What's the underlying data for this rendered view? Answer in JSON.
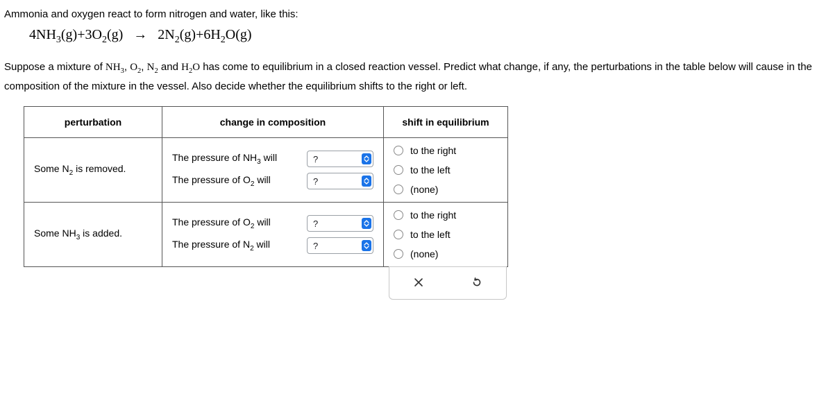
{
  "intro": {
    "line1": "Ammonia and oxygen react to form nitrogen and water, like this:",
    "eqn_lhs1": "4NH",
    "eqn_lhs1_sub": "3",
    "eqn_lhs1_state": "(g)",
    "eqn_plus1": "+",
    "eqn_lhs2": "3O",
    "eqn_lhs2_sub": "2",
    "eqn_lhs2_state": "(g)",
    "arrow": "→",
    "eqn_rhs1": "2N",
    "eqn_rhs1_sub": "2",
    "eqn_rhs1_state": "(g)",
    "eqn_plus2": "+",
    "eqn_rhs2": "6H",
    "eqn_rhs2_sub": "2",
    "eqn_rhs2_o": "O",
    "eqn_rhs2_state": "(g)",
    "line2a": "Suppose a mixture of ",
    "mix1": "NH",
    "mix1_sub": "3",
    "sep1": ", ",
    "mix2": "O",
    "mix2_sub": "2",
    "sep2": ", ",
    "mix3": "N",
    "mix3_sub": "2",
    "sep3": " and ",
    "mix4a": "H",
    "mix4_sub": "2",
    "mix4b": "O",
    "line2b": " has come to equilibrium in a closed reaction vessel. Predict what change, if any, the perturbations in the table below will cause in the composition of the mixture in the vessel. Also decide whether the equilibrium shifts to the right or left."
  },
  "headers": {
    "perturbation": "perturbation",
    "change": "change in composition",
    "shift": "shift in equilibrium"
  },
  "rows": [
    {
      "pert_a": "Some N",
      "pert_sub": "2",
      "pert_b": " is removed.",
      "comp": [
        {
          "pre": "The pressure of NH",
          "sub": "3",
          "post": " will",
          "value": "?"
        },
        {
          "pre": "The pressure of O",
          "sub": "2",
          "post": " will",
          "value": "?"
        }
      ]
    },
    {
      "pert_a": "Some NH",
      "pert_sub": "3",
      "pert_b": " is added.",
      "comp": [
        {
          "pre": "The pressure of O",
          "sub": "2",
          "post": " will",
          "value": "?"
        },
        {
          "pre": "The pressure of N",
          "sub": "2",
          "post": " will",
          "value": "?"
        }
      ]
    }
  ],
  "shift_options": {
    "right": "to the right",
    "left": "to the left",
    "none": "(none)"
  },
  "icons": {
    "close": "close-icon",
    "reset": "reset-icon"
  }
}
